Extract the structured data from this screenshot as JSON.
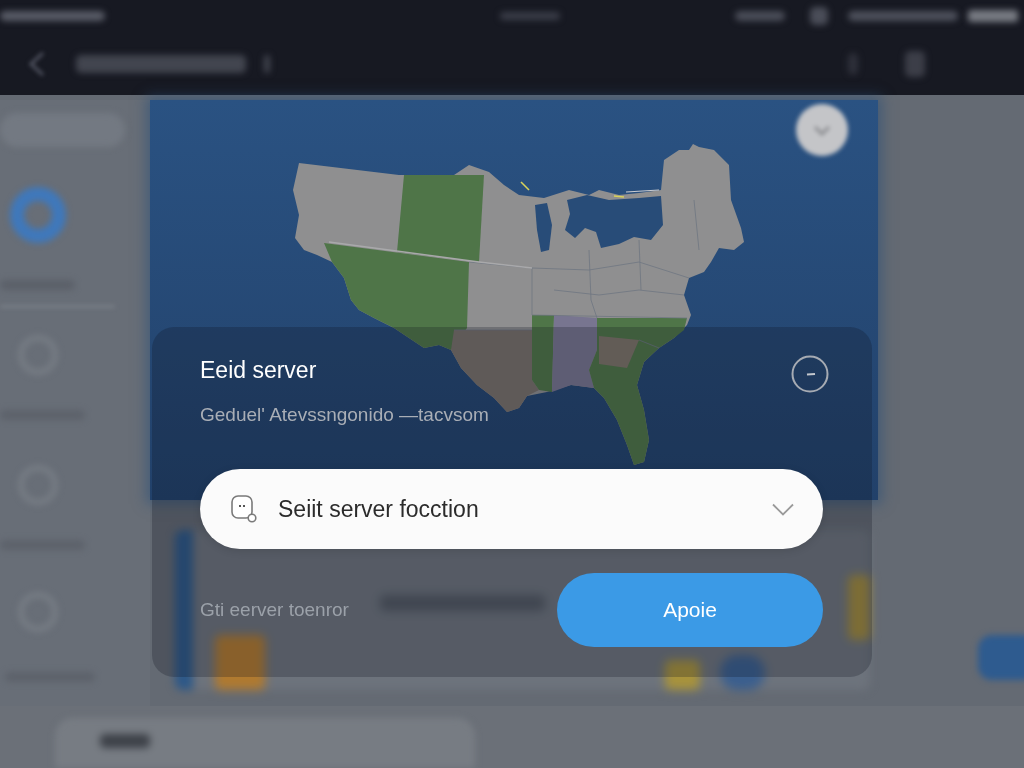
{
  "dialog": {
    "title": "Eeid server",
    "subtitle": "Geduel' Atevssngonido —tacvsom",
    "server_select": {
      "label": "Seiit server focction"
    },
    "footer_text": "Gti eerver toenror",
    "buttons": [
      "Apoie"
    ]
  }
}
